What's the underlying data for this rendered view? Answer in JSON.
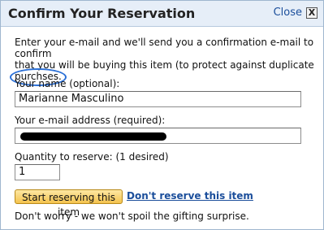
{
  "dialog": {
    "title": "Confirm Your Reservation",
    "close_label": "Close",
    "close_glyph": "X"
  },
  "intro": {
    "line1": "Enter your e-mail and we'll send you a confirmation e-mail to confirm",
    "line2": "that you will be buying this item (to protect against duplicate",
    "line3": "purchses."
  },
  "form": {
    "name_label": "Your name (optional):",
    "name_value": "Marianne Masculino",
    "email_label": "Your e-mail address (required):",
    "quantity_label": "Quantity to reserve: (1 desired)",
    "quantity_value": "1"
  },
  "actions": {
    "start_label": "Start reserving this item",
    "dont_label": "Don't reserve this item"
  },
  "footer": {
    "note": "Don't worry - we won't spoil the gifting surprise."
  },
  "colors": {
    "link": "#1b4e9b",
    "button_top": "#fde7a3",
    "button_bottom": "#f4c34e",
    "annotation_circle": "#2a6fd6"
  }
}
